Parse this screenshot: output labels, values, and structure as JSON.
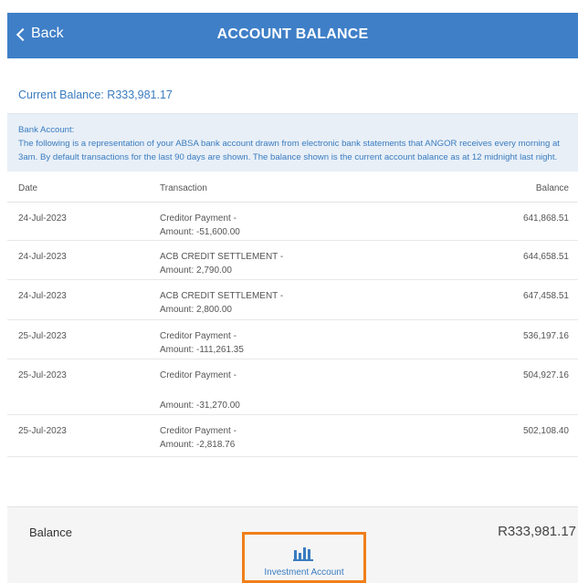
{
  "header": {
    "back_label": "Back",
    "title": "ACCOUNT BALANCE"
  },
  "current_balance": {
    "label": "Current Balance:",
    "amount": "R333,981.17"
  },
  "info": {
    "heading": "Bank Account:",
    "text": "The following is a representation of your ABSA bank account drawn from electronic bank statements that ANGOR receives every morning at 3am. By default transactions for the last 90 days are shown. The balance shown is the current account balance as at 12 midnight last night."
  },
  "table": {
    "columns": [
      "Date",
      "Transaction",
      "Balance"
    ],
    "rows": [
      {
        "date": "24-Jul-2023",
        "desc": "Creditor Payment -",
        "amount": "Amount: -51,600.00",
        "balance": "641,868.51"
      },
      {
        "date": "24-Jul-2023",
        "desc": "ACB CREDIT SETTLEMENT -",
        "amount": "Amount: 2,790.00",
        "balance": "644,658.51"
      },
      {
        "date": "24-Jul-2023",
        "desc": "ACB CREDIT SETTLEMENT -",
        "amount": "Amount: 2,800.00",
        "balance": "647,458.51"
      },
      {
        "date": "25-Jul-2023",
        "desc": "Creditor Payment -",
        "amount": "Amount: -111,261.35",
        "balance": "536,197.16"
      },
      {
        "date": "25-Jul-2023",
        "desc": "Creditor Payment -",
        "amount": "Amount: -31,270.00",
        "balance": "504,927.16"
      },
      {
        "date": "25-Jul-2023",
        "desc": "Creditor Payment -",
        "amount": "Amount: -2,818.76",
        "balance": "502,108.40"
      }
    ]
  },
  "footer": {
    "balance_label": "Balance",
    "balance_value": "R333,981.17",
    "investment_label": "Investment Account",
    "investment_icon": "bar-chart-icon",
    "highlight_color": "#f07f1a",
    "brand_color": "#3f7fc7"
  }
}
